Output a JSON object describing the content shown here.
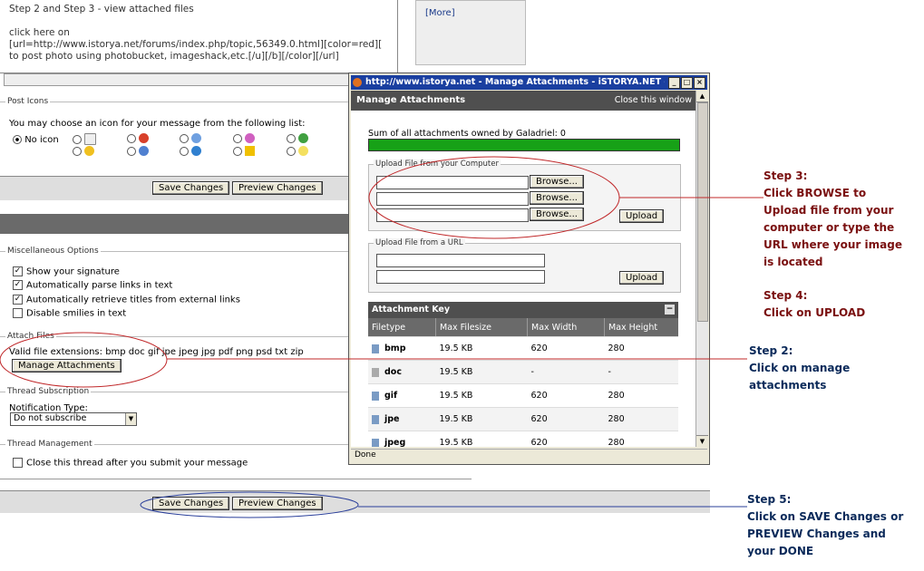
{
  "top_text": {
    "line1": "Step 2 and Step 3 - view attached files",
    "line2": "click here on",
    "line3": "[url=http://www.istorya.net/forums/index.php/topic,56349.0.html][color=red][",
    "line4": "to post photo using photobucket, imageshack,etc.[/u][/b][/color][/url]",
    "more_link": "[More]"
  },
  "post_icons": {
    "legend": "Post Icons",
    "prompt": "You may choose an icon for your message from the following list:",
    "no_icon_label": "No icon"
  },
  "buttons": {
    "save_changes": "Save Changes",
    "preview_changes": "Preview Changes"
  },
  "misc": {
    "legend": "Miscellaneous Options",
    "options": [
      {
        "label": "Show your signature",
        "checked": true
      },
      {
        "label": "Automatically parse links in text",
        "checked": true
      },
      {
        "label": "Automatically retrieve titles from external links",
        "checked": true
      },
      {
        "label": "Disable smilies in text",
        "checked": false
      }
    ]
  },
  "attach": {
    "legend": "Attach Files",
    "extensions": "Valid file extensions: bmp doc gif jpe jpeg jpg pdf png psd txt zip",
    "manage_button": "Manage Attachments"
  },
  "subscription": {
    "legend": "Thread Subscription",
    "label": "Notification Type:",
    "selected": "Do not subscribe"
  },
  "management": {
    "legend": "Thread Management",
    "close_label": "Close this thread after you submit your message"
  },
  "popup": {
    "window_title": "http://www.istorya.net - Manage Attachments - iSTORYA.NET - Mozilla...",
    "header_title": "Manage Attachments",
    "close_window": "Close this window",
    "sum_label": "Sum of all attachments owned by Galadriel: 0",
    "upload_computer_legend": "Upload File from your Computer",
    "browse_label": "Browse...",
    "upload_label": "Upload",
    "upload_url_legend": "Upload File from a URL",
    "key_title": "Attachment Key",
    "key_toggle": "−",
    "columns": [
      "Filetype",
      "Max Filesize",
      "Max Width",
      "Max Height"
    ],
    "rows": [
      [
        "bmp",
        "19.5 KB",
        "620",
        "280"
      ],
      [
        "doc",
        "19.5 KB",
        "-",
        "-"
      ],
      [
        "gif",
        "19.5 KB",
        "620",
        "280"
      ],
      [
        "jpe",
        "19.5 KB",
        "620",
        "280"
      ],
      [
        "jpeg",
        "19.5 KB",
        "620",
        "280"
      ]
    ],
    "status": "Done"
  },
  "annotations": {
    "step3": [
      "Step 3:",
      "Click BROWSE to",
      "Upload file from your",
      "computer or type the",
      "URL where your image",
      "is located"
    ],
    "step4": [
      "Step 4:",
      "Click on UPLOAD"
    ],
    "step2": [
      "Step 2:",
      "Click on manage attachments"
    ],
    "step5": [
      "Step 5:",
      "Click on SAVE Changes or",
      "PREVIEW Changes and",
      "your DONE"
    ]
  },
  "colors": {
    "progress_green": "#17a117",
    "annotation_red": "#7a1010",
    "annotation_blue": "#0b2a5a",
    "ellipse_red": "#c0282a",
    "ellipse_blue": "#2a3f9a"
  }
}
